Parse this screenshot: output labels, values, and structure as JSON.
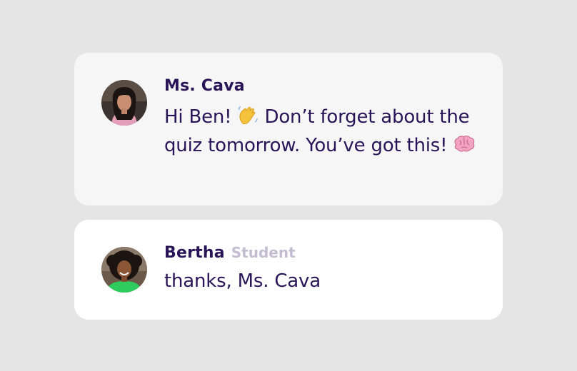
{
  "messages": [
    {
      "sender": "Ms. Cava",
      "role": "",
      "text_part1": "Hi Ben! ",
      "emoji1": "waving-hand-icon",
      "text_part2": " Don’t forget about the quiz tomorrow. You’ve got this! ",
      "emoji2": "brain-icon"
    },
    {
      "sender": "Bertha",
      "role": "Student",
      "text": "thanks, Ms. Cava"
    }
  ],
  "colors": {
    "background": "#e5e5e5",
    "card_teacher": "#f6f6f6",
    "card_student": "#ffffff",
    "text_primary": "#2a1458",
    "role_text": "#c4bdd2"
  }
}
